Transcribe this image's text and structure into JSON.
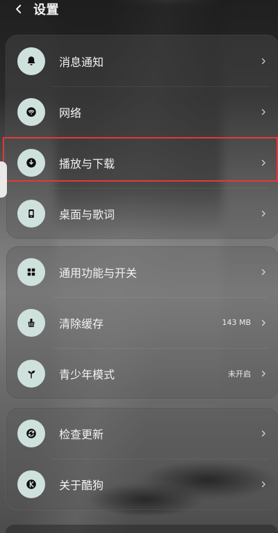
{
  "header": {
    "title": "设置"
  },
  "groups": [
    {
      "items": [
        {
          "label": "消息通知",
          "value": ""
        },
        {
          "label": "网络",
          "value": ""
        },
        {
          "label": "播放与下载",
          "value": ""
        },
        {
          "label": "桌面与歌词",
          "value": ""
        }
      ]
    },
    {
      "items": [
        {
          "label": "通用功能与开关",
          "value": ""
        },
        {
          "label": "清除缓存",
          "value": "143 MB"
        },
        {
          "label": "青少年模式",
          "value": "未开启"
        }
      ]
    },
    {
      "items": [
        {
          "label": "检查更新",
          "value": ""
        },
        {
          "label": "关于酷狗",
          "value": ""
        }
      ]
    }
  ],
  "colors": {
    "icon_bg": "#cfe1dc",
    "icon_fg": "#0f0f0f",
    "highlight": "#e53935"
  },
  "icons": {
    "back": "back-arrow-icon",
    "bell": "bell-icon",
    "wifi": "wifi-icon",
    "download": "download-icon",
    "lyrics": "lyrics-desktop-icon",
    "grid": "grid-icon",
    "broom": "broom-icon",
    "sprout": "sprout-icon",
    "sync": "sync-icon",
    "about": "about-k-icon",
    "chevron": "chevron-right-icon"
  }
}
